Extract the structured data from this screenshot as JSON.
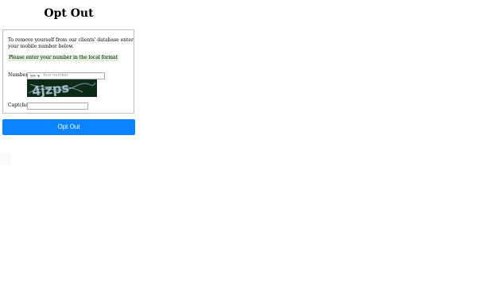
{
  "page": {
    "title": "Opt Out"
  },
  "form": {
    "intro": "To remove yourself from our clients' database enter your mobile number below.",
    "hint": "Please enter your number in the local format",
    "number_label": "Number",
    "number_placeholder": "Your number",
    "captcha_image_text": "4jzps",
    "captcha_label": "Captcha",
    "captcha_value": "",
    "submit_label": "Opt Out"
  },
  "colors": {
    "accent": "#0d84ff",
    "hint_background": "#dff0d8",
    "captcha_background": "#0c2a16"
  },
  "icons": {
    "country_flag": "flag-icon",
    "dropdown": "chevron-down-icon"
  }
}
